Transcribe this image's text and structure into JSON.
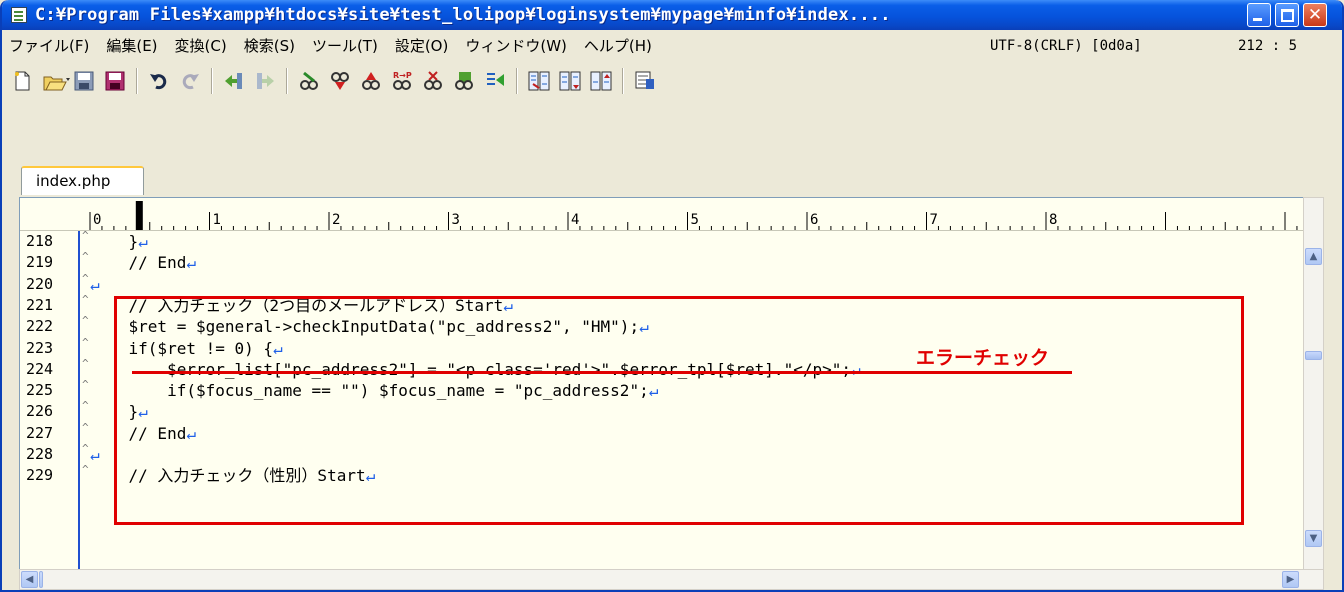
{
  "window": {
    "title": "C:¥Program Files¥xampp¥htdocs¥site¥test_lolipop¥loginsystem¥mypage¥minfo¥index...."
  },
  "menu": [
    "ファイル(F)",
    "編集(E)",
    "変換(C)",
    "検索(S)",
    "ツール(T)",
    "設定(O)",
    "ウィンドウ(W)",
    "ヘルプ(H)"
  ],
  "status": {
    "encoding": "UTF-8(CRLF) [0d0a]",
    "position": "212 : 5"
  },
  "tab": {
    "label": "index.php"
  },
  "ruler": {
    "marks": [
      "0",
      "1",
      "2",
      "3",
      "4",
      "5",
      "6",
      "7",
      "8"
    ]
  },
  "lines": [
    {
      "num": "218",
      "text": "    }"
    },
    {
      "num": "219",
      "text": "    // End"
    },
    {
      "num": "220",
      "text": ""
    },
    {
      "num": "221",
      "text": "    // 入力チェック（2つ目のメールアドレス）Start"
    },
    {
      "num": "222",
      "text": "    $ret = $general->checkInputData(\"pc_address2\", \"HM\");"
    },
    {
      "num": "223",
      "text": "    if($ret != 0) {"
    },
    {
      "num": "224",
      "text": "        $error_list[\"pc_address2\"] = \"<p class='red'>\".$error_tpl[$ret].\"</p>\";"
    },
    {
      "num": "225",
      "text": "        if($focus_name == \"\") $focus_name = \"pc_address2\";"
    },
    {
      "num": "226",
      "text": "    }"
    },
    {
      "num": "227",
      "text": "    // End"
    },
    {
      "num": "228",
      "text": ""
    },
    {
      "num": "229",
      "text": "    // 入力チェック（性別）Start"
    }
  ],
  "annotation": {
    "label": "エラーチェック",
    "color": "#e00000"
  }
}
